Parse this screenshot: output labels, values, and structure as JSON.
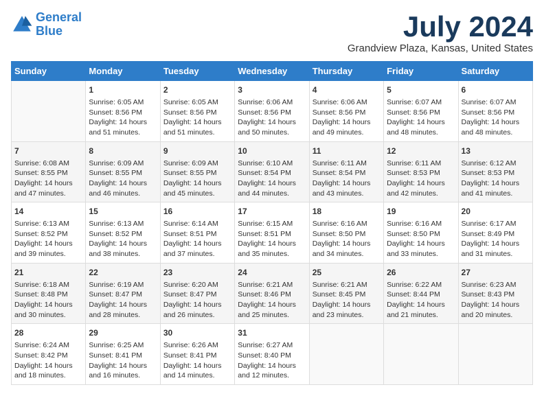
{
  "logo": {
    "line1": "General",
    "line2": "Blue"
  },
  "title": "July 2024",
  "location": "Grandview Plaza, Kansas, United States",
  "days_of_week": [
    "Sunday",
    "Monday",
    "Tuesday",
    "Wednesday",
    "Thursday",
    "Friday",
    "Saturday"
  ],
  "weeks": [
    [
      {
        "day": "",
        "content": ""
      },
      {
        "day": "1",
        "content": "Sunrise: 6:05 AM\nSunset: 8:56 PM\nDaylight: 14 hours\nand 51 minutes."
      },
      {
        "day": "2",
        "content": "Sunrise: 6:05 AM\nSunset: 8:56 PM\nDaylight: 14 hours\nand 51 minutes."
      },
      {
        "day": "3",
        "content": "Sunrise: 6:06 AM\nSunset: 8:56 PM\nDaylight: 14 hours\nand 50 minutes."
      },
      {
        "day": "4",
        "content": "Sunrise: 6:06 AM\nSunset: 8:56 PM\nDaylight: 14 hours\nand 49 minutes."
      },
      {
        "day": "5",
        "content": "Sunrise: 6:07 AM\nSunset: 8:56 PM\nDaylight: 14 hours\nand 48 minutes."
      },
      {
        "day": "6",
        "content": "Sunrise: 6:07 AM\nSunset: 8:56 PM\nDaylight: 14 hours\nand 48 minutes."
      }
    ],
    [
      {
        "day": "7",
        "content": "Sunrise: 6:08 AM\nSunset: 8:55 PM\nDaylight: 14 hours\nand 47 minutes."
      },
      {
        "day": "8",
        "content": "Sunrise: 6:09 AM\nSunset: 8:55 PM\nDaylight: 14 hours\nand 46 minutes."
      },
      {
        "day": "9",
        "content": "Sunrise: 6:09 AM\nSunset: 8:55 PM\nDaylight: 14 hours\nand 45 minutes."
      },
      {
        "day": "10",
        "content": "Sunrise: 6:10 AM\nSunset: 8:54 PM\nDaylight: 14 hours\nand 44 minutes."
      },
      {
        "day": "11",
        "content": "Sunrise: 6:11 AM\nSunset: 8:54 PM\nDaylight: 14 hours\nand 43 minutes."
      },
      {
        "day": "12",
        "content": "Sunrise: 6:11 AM\nSunset: 8:53 PM\nDaylight: 14 hours\nand 42 minutes."
      },
      {
        "day": "13",
        "content": "Sunrise: 6:12 AM\nSunset: 8:53 PM\nDaylight: 14 hours\nand 41 minutes."
      }
    ],
    [
      {
        "day": "14",
        "content": "Sunrise: 6:13 AM\nSunset: 8:52 PM\nDaylight: 14 hours\nand 39 minutes."
      },
      {
        "day": "15",
        "content": "Sunrise: 6:13 AM\nSunset: 8:52 PM\nDaylight: 14 hours\nand 38 minutes."
      },
      {
        "day": "16",
        "content": "Sunrise: 6:14 AM\nSunset: 8:51 PM\nDaylight: 14 hours\nand 37 minutes."
      },
      {
        "day": "17",
        "content": "Sunrise: 6:15 AM\nSunset: 8:51 PM\nDaylight: 14 hours\nand 35 minutes."
      },
      {
        "day": "18",
        "content": "Sunrise: 6:16 AM\nSunset: 8:50 PM\nDaylight: 14 hours\nand 34 minutes."
      },
      {
        "day": "19",
        "content": "Sunrise: 6:16 AM\nSunset: 8:50 PM\nDaylight: 14 hours\nand 33 minutes."
      },
      {
        "day": "20",
        "content": "Sunrise: 6:17 AM\nSunset: 8:49 PM\nDaylight: 14 hours\nand 31 minutes."
      }
    ],
    [
      {
        "day": "21",
        "content": "Sunrise: 6:18 AM\nSunset: 8:48 PM\nDaylight: 14 hours\nand 30 minutes."
      },
      {
        "day": "22",
        "content": "Sunrise: 6:19 AM\nSunset: 8:47 PM\nDaylight: 14 hours\nand 28 minutes."
      },
      {
        "day": "23",
        "content": "Sunrise: 6:20 AM\nSunset: 8:47 PM\nDaylight: 14 hours\nand 26 minutes."
      },
      {
        "day": "24",
        "content": "Sunrise: 6:21 AM\nSunset: 8:46 PM\nDaylight: 14 hours\nand 25 minutes."
      },
      {
        "day": "25",
        "content": "Sunrise: 6:21 AM\nSunset: 8:45 PM\nDaylight: 14 hours\nand 23 minutes."
      },
      {
        "day": "26",
        "content": "Sunrise: 6:22 AM\nSunset: 8:44 PM\nDaylight: 14 hours\nand 21 minutes."
      },
      {
        "day": "27",
        "content": "Sunrise: 6:23 AM\nSunset: 8:43 PM\nDaylight: 14 hours\nand 20 minutes."
      }
    ],
    [
      {
        "day": "28",
        "content": "Sunrise: 6:24 AM\nSunset: 8:42 PM\nDaylight: 14 hours\nand 18 minutes."
      },
      {
        "day": "29",
        "content": "Sunrise: 6:25 AM\nSunset: 8:41 PM\nDaylight: 14 hours\nand 16 minutes."
      },
      {
        "day": "30",
        "content": "Sunrise: 6:26 AM\nSunset: 8:41 PM\nDaylight: 14 hours\nand 14 minutes."
      },
      {
        "day": "31",
        "content": "Sunrise: 6:27 AM\nSunset: 8:40 PM\nDaylight: 14 hours\nand 12 minutes."
      },
      {
        "day": "",
        "content": ""
      },
      {
        "day": "",
        "content": ""
      },
      {
        "day": "",
        "content": ""
      }
    ]
  ]
}
